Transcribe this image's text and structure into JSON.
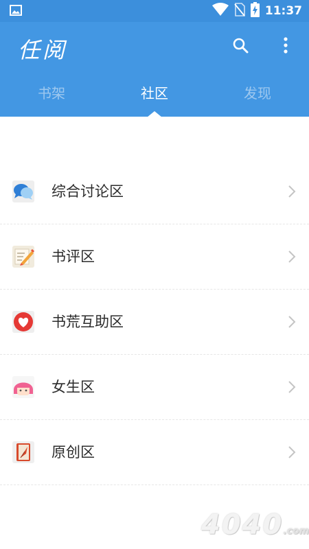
{
  "status_bar": {
    "time": "11:37",
    "icons": [
      "image-icon",
      "wifi-icon",
      "no-sim-icon",
      "battery-charging-icon"
    ]
  },
  "app_bar": {
    "title": "任阅",
    "actions": [
      "search-icon",
      "more-vert-icon"
    ],
    "color": "#4397e3"
  },
  "tabs": [
    {
      "label": "书架",
      "active": false
    },
    {
      "label": "社区",
      "active": true
    },
    {
      "label": "发现",
      "active": false
    }
  ],
  "community_list": [
    {
      "label": "综合讨论区",
      "icon": "chat-bubbles-icon"
    },
    {
      "label": "书评区",
      "icon": "pencil-note-icon"
    },
    {
      "label": "书荒互助区",
      "icon": "heart-icon"
    },
    {
      "label": "女生区",
      "icon": "girl-face-icon"
    },
    {
      "label": "原创区",
      "icon": "book-quill-icon"
    }
  ],
  "watermark": {
    "text": "4040",
    "domain": ".com"
  }
}
